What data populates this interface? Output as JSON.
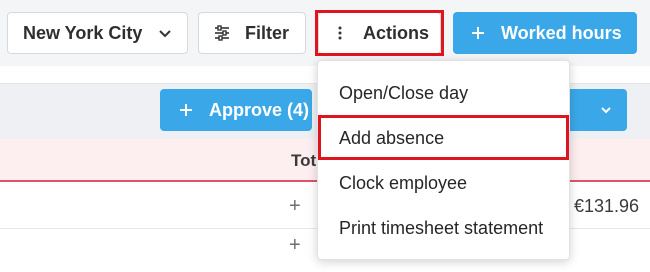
{
  "toolbar": {
    "city_select_value": "New York City",
    "filter_label": "Filter",
    "actions_label": "Actions",
    "worked_hours_label": "Worked hours"
  },
  "approve": {
    "label": "Approve (4)"
  },
  "table": {
    "header_total": "Tot",
    "rows": [
      {
        "plus": "+",
        "amount": "€131.96"
      },
      {
        "plus": "+",
        "amount": ""
      }
    ]
  },
  "actions_menu": {
    "items": [
      "Open/Close day",
      "Add absence",
      "Clock employee",
      "Print timesheet statement"
    ]
  },
  "icons": {
    "city_chevron": "chevron-down-icon",
    "filter": "sliders-icon",
    "actions": "vertical-dots-icon",
    "worked_hours": "plus-icon",
    "approve": "plus-icon",
    "approve_dropdown": "chevron-down-icon"
  },
  "colors": {
    "primary": "#3aa8e8",
    "highlight": "#e0141e",
    "header_row_bg": "#fdeef0",
    "header_row_border": "#e4506a"
  }
}
